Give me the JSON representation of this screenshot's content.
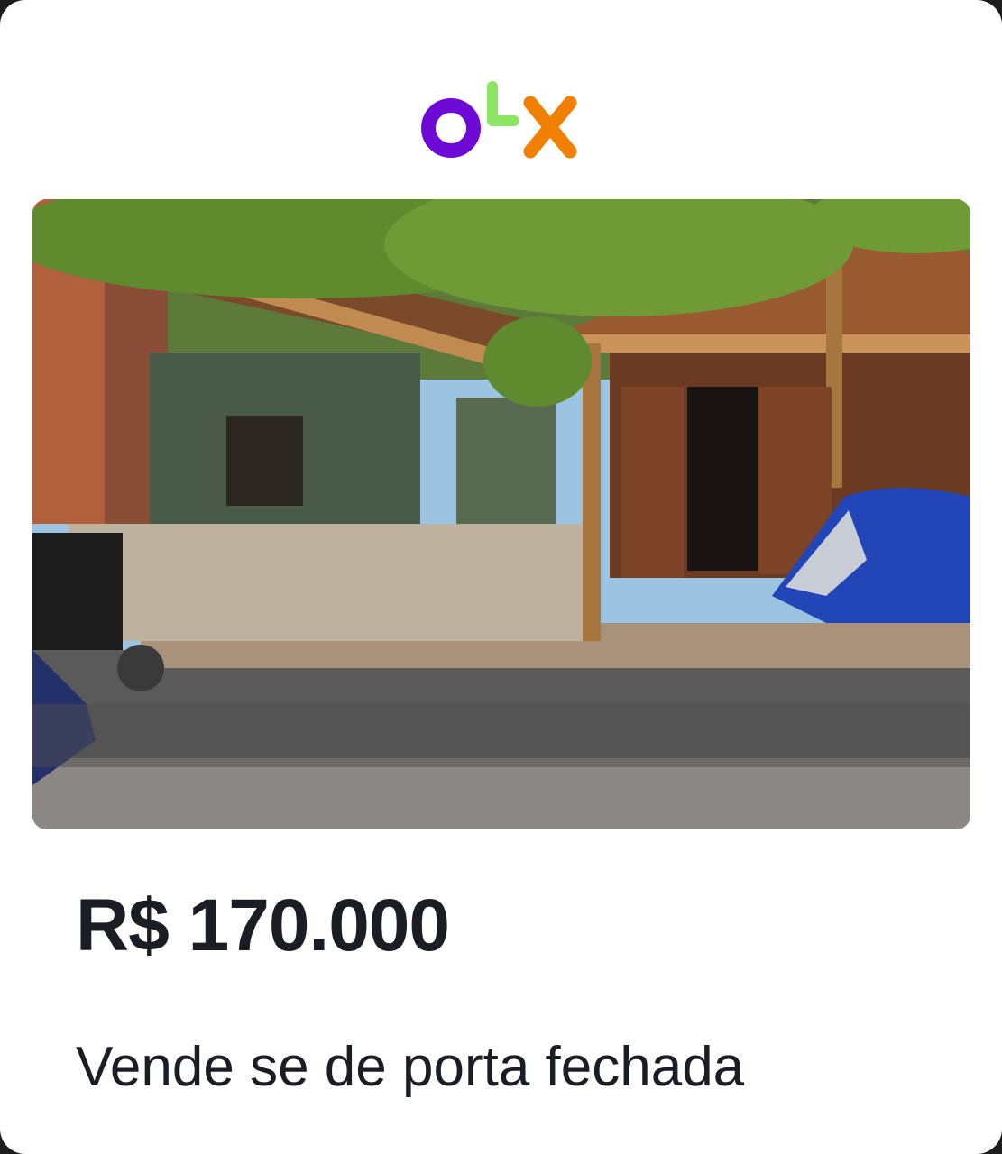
{
  "brand": {
    "logo_text": "OLX",
    "colors": {
      "o": "#6e0ad6",
      "l": "#8ce563",
      "x": "#f28000"
    }
  },
  "listing": {
    "image_alt": "House with wooden doors, covered terrace, motorcycle and blue tent on gravel",
    "price": "R$ 170.000",
    "title": "Vende se de porta fechada"
  }
}
